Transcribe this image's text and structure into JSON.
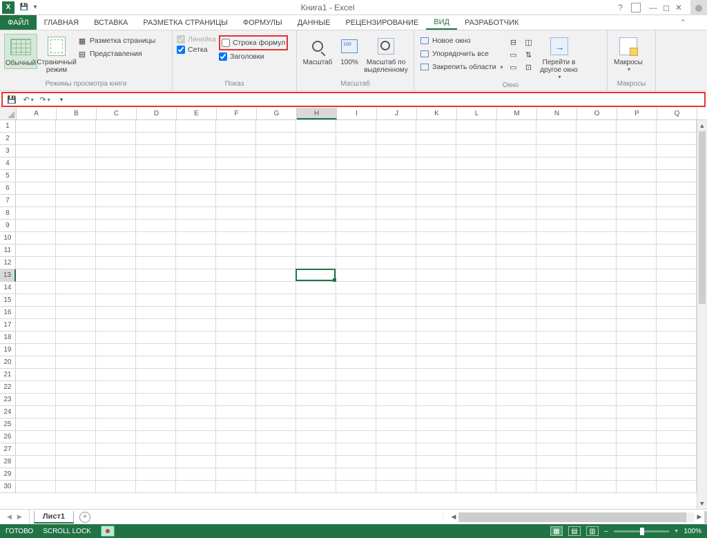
{
  "title": "Книга1 - Excel",
  "tabs": {
    "file": "ФАЙЛ",
    "home": "ГЛАВНАЯ",
    "insert": "ВСТАВКА",
    "layout": "РАЗМЕТКА СТРАНИЦЫ",
    "formulas": "ФОРМУЛЫ",
    "data": "ДАННЫЕ",
    "review": "РЕЦЕНЗИРОВАНИЕ",
    "view": "ВИД",
    "dev": "РАЗРАБОТЧИК"
  },
  "ribbon": {
    "views": {
      "normal": "Обычный",
      "page_break": "Страничный\nрежим",
      "page_layout": "Разметка страницы",
      "custom": "Представления",
      "group": "Режимы просмотра книги"
    },
    "show": {
      "ruler": "Линейка",
      "formula_bar": "Строка формул",
      "gridlines": "Сетка",
      "headings": "Заголовки",
      "group": "Показ"
    },
    "zoom": {
      "zoom": "Масштаб",
      "z100": "100%",
      "to_sel": "Масштаб по\nвыделенному",
      "group": "Масштаб"
    },
    "window": {
      "new": "Новое окно",
      "arrange": "Упорядочить все",
      "freeze": "Закрепить области",
      "switch": "Перейти в\nдругое окно",
      "group": "Окно"
    },
    "macros": {
      "macros": "Макросы",
      "group": "Макросы"
    }
  },
  "columns": [
    "A",
    "B",
    "C",
    "D",
    "E",
    "F",
    "G",
    "H",
    "I",
    "J",
    "K",
    "L",
    "M",
    "N",
    "O",
    "P",
    "Q"
  ],
  "rows": [
    "1",
    "2",
    "3",
    "4",
    "5",
    "6",
    "7",
    "8",
    "9",
    "10",
    "11",
    "12",
    "13",
    "14",
    "15",
    "16",
    "17",
    "18",
    "19",
    "20",
    "21",
    "22",
    "23",
    "24",
    "25",
    "26",
    "27",
    "28",
    "29",
    "30"
  ],
  "active": {
    "col": "H",
    "row": "13",
    "colIndex": 7,
    "rowIndex": 12
  },
  "sheet": "Лист1",
  "status": {
    "ready": "ГОТОВО",
    "scroll": "SCROLL LOCK",
    "zoom": "100%"
  }
}
